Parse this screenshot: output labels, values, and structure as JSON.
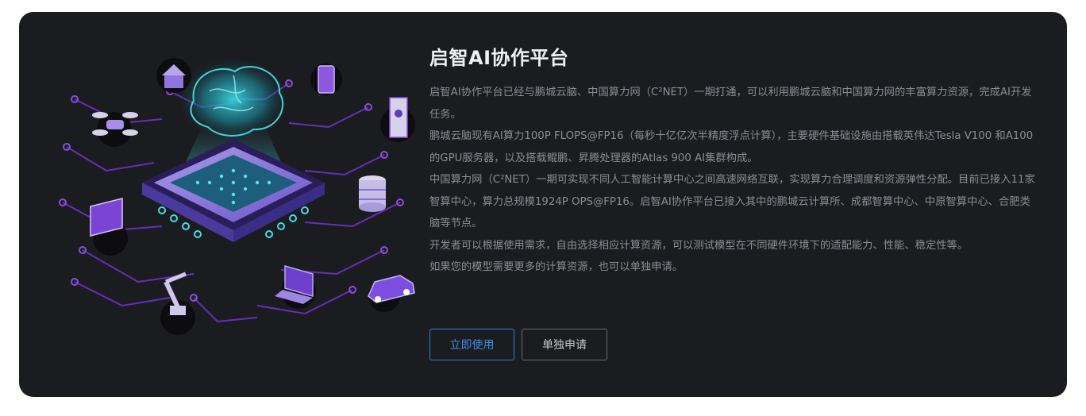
{
  "platform": {
    "title": "启智AI协作平台",
    "paragraphs": [
      "启智AI协作平台已经与鹏城云脑、中国算力网（C²NET）一期打通，可以利用鹏城云脑和中国算力网的丰富算力资源，完成AI开发任务。",
      "鹏城云脑现有AI算力100P FLOPS@FP16（每秒十亿亿次半精度浮点计算），主要硬件基础设施由搭载英伟达Tesla V100 和A100 的GPU服务器，以及搭载鲲鹏、昇腾处理器的Atlas 900 AI集群构成。",
      "中国算力网（C²NET）一期可实现不同人工智能计算中心之间高速网络互联，实现算力合理调度和资源弹性分配。目前已接入11家智算中心，算力总规模1924P OPS@FP16。启智AI协作平台已接入其中的鹏城云计算所、成都智算中心、中原智算中心、合肥类脑等节点。",
      "开发者可以根据使用需求，自由选择相应计算资源，可以测试模型在不同硬件环境下的适配能力、性能、稳定性等。",
      "如果您的模型需要更多的计算资源，也可以单独申请。"
    ],
    "buttons": {
      "use_now": "立即使用",
      "apply": "单独申请"
    }
  },
  "colors": {
    "card_bg": "#1b1c1f",
    "accent_blue": "#3b8fe6",
    "circuit_purple": "#7b3fd6",
    "neon_cyan": "#37d7e6"
  },
  "illustration": {
    "icons": [
      "drone-icon",
      "house-icon",
      "tablet-icon",
      "server-rack-icon",
      "database-icon",
      "monitor-icon",
      "robot-arm-icon",
      "laptop-icon",
      "car-icon",
      "brain-icon",
      "ai-chip-icon"
    ]
  }
}
